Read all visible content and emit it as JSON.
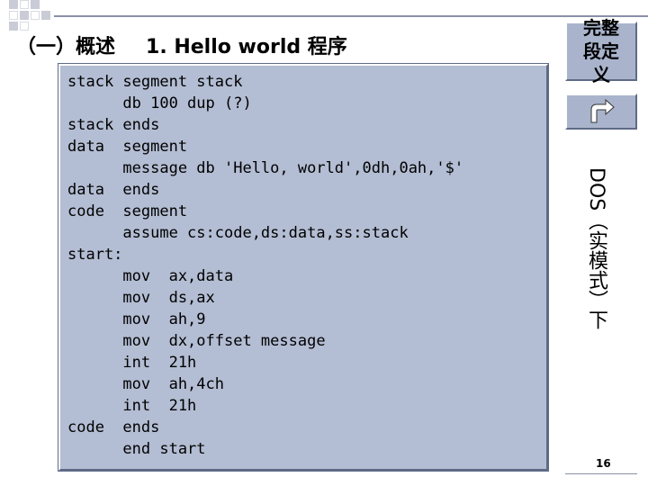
{
  "header": {
    "section_title": "（一）概述",
    "subtitle": "1. Hello world 程序"
  },
  "code": {
    "lines": [
      "stack segment stack",
      "      db 100 dup (?)",
      "stack ends",
      "data  segment",
      "      message db 'Hello, world',0dh,0ah,'$'",
      "data  ends",
      "code  segment",
      "      assume cs:code,ds:data,ss:stack",
      "start:",
      "      mov  ax,data",
      "      mov  ds,ax",
      "      mov  ah,9",
      "      mov  dx,offset message",
      "      int  21h",
      "      mov  ah,4ch",
      "      int  21h",
      "code  ends",
      "      end start"
    ]
  },
  "sidebar": {
    "full_segment_button": "完整段定义",
    "return_icon": "return-arrow-icon",
    "vertical_note": "DOS（实模式）下"
  },
  "footer": {
    "page_number": "16"
  }
}
